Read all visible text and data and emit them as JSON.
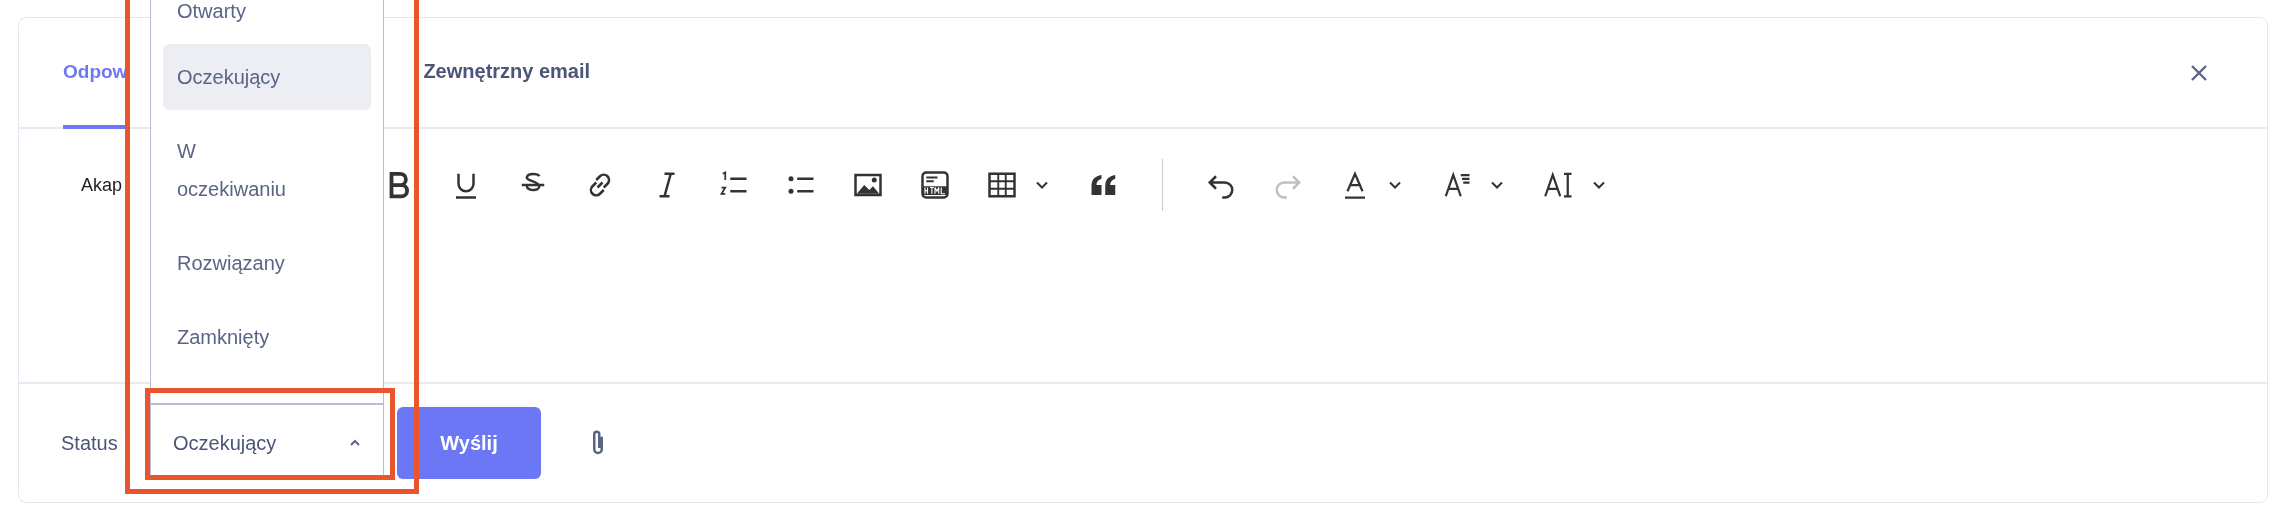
{
  "tabs": [
    {
      "label": "Odpow",
      "selected": true
    },
    {
      "label": "Zewnętrzny email",
      "selected": false
    }
  ],
  "toolbar": {
    "paragraph_select": "Akap",
    "items": [
      {
        "kind": "bold",
        "disabled": false
      },
      {
        "kind": "underline",
        "disabled": false
      },
      {
        "kind": "strike",
        "disabled": false
      },
      {
        "kind": "link",
        "disabled": false
      },
      {
        "kind": "italic",
        "disabled": false
      },
      {
        "kind": "ordered-list",
        "disabled": false
      },
      {
        "kind": "bullet-list",
        "disabled": false
      },
      {
        "kind": "image",
        "disabled": false
      },
      {
        "kind": "html",
        "disabled": false
      },
      {
        "kind": "table",
        "disabled": false
      },
      {
        "kind": "caret",
        "disabled": false
      },
      {
        "kind": "quote",
        "disabled": false
      },
      {
        "kind": "separator"
      },
      {
        "kind": "undo",
        "disabled": false
      },
      {
        "kind": "redo",
        "disabled": true
      },
      {
        "kind": "font-color",
        "disabled": false
      },
      {
        "kind": "caret",
        "disabled": false
      },
      {
        "kind": "text-format",
        "disabled": false
      },
      {
        "kind": "caret",
        "disabled": false
      },
      {
        "kind": "line-height",
        "disabled": false
      },
      {
        "kind": "caret",
        "disabled": false
      }
    ]
  },
  "status": {
    "label": "Status",
    "value": "Oczekujący",
    "expanded": true,
    "options": [
      {
        "label": "Otwarty",
        "selected": false
      },
      {
        "label": "Oczekujący",
        "selected": true
      },
      {
        "label": "W oczekiwaniu",
        "selected": false
      },
      {
        "label": "Rozwiązany",
        "selected": false
      },
      {
        "label": "Zamknięty",
        "selected": false
      }
    ]
  },
  "send_button": "Wyślij"
}
